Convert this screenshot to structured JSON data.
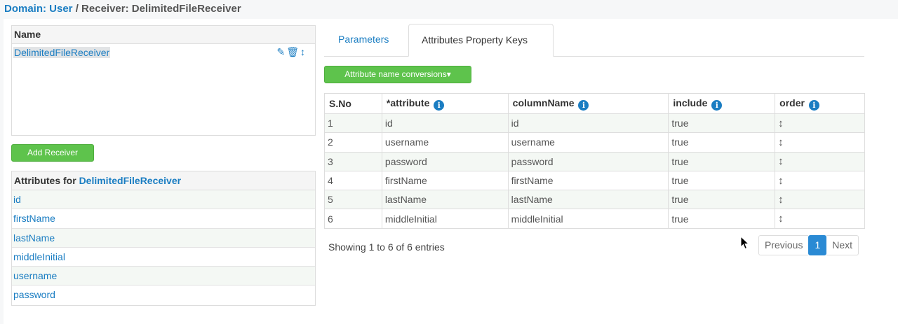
{
  "breadcrumb": {
    "domain_label": "Domain: User",
    "separator": " / ",
    "receiver_label": "Receiver: DelimitedFileReceiver"
  },
  "receivers": {
    "header": "Name",
    "items": [
      {
        "name": "DelimitedFileReceiver",
        "icons": [
          "edit-icon",
          "trash-icon",
          "move-icon"
        ]
      }
    ],
    "add_button": "Add Receiver"
  },
  "attributes": {
    "header_prefix": "Attributes for ",
    "header_receiver": "DelimitedFileReceiver",
    "items": [
      "id",
      "firstName",
      "lastName",
      "middleInitial",
      "username",
      "password"
    ]
  },
  "tabs": [
    {
      "label": "Parameters",
      "active": false
    },
    {
      "label": "Attributes Property Keys",
      "active": true
    }
  ],
  "conversions_button": "Attribute name conversions▾",
  "table": {
    "columns": [
      "S.No",
      "*attribute",
      "columnName",
      "include",
      "order"
    ],
    "rows": [
      {
        "sno": "1",
        "attribute": "id",
        "column": "id",
        "include": "true"
      },
      {
        "sno": "2",
        "attribute": "username",
        "column": "username",
        "include": "true"
      },
      {
        "sno": "3",
        "attribute": "password",
        "column": "password",
        "include": "true"
      },
      {
        "sno": "4",
        "attribute": "firstName",
        "column": "firstName",
        "include": "true"
      },
      {
        "sno": "5",
        "attribute": "lastName",
        "column": "lastName",
        "include": "true"
      },
      {
        "sno": "6",
        "attribute": "middleInitial",
        "column": "middleInitial",
        "include": "true"
      }
    ]
  },
  "summary": "Showing 1 to 6 of 6 entries",
  "pagination": {
    "previous": "Previous",
    "current": "1",
    "next": "Next"
  },
  "colors": {
    "link": "#1a7dc2",
    "button_green": "#5ec34c",
    "pager_active": "#2a8ad4"
  }
}
